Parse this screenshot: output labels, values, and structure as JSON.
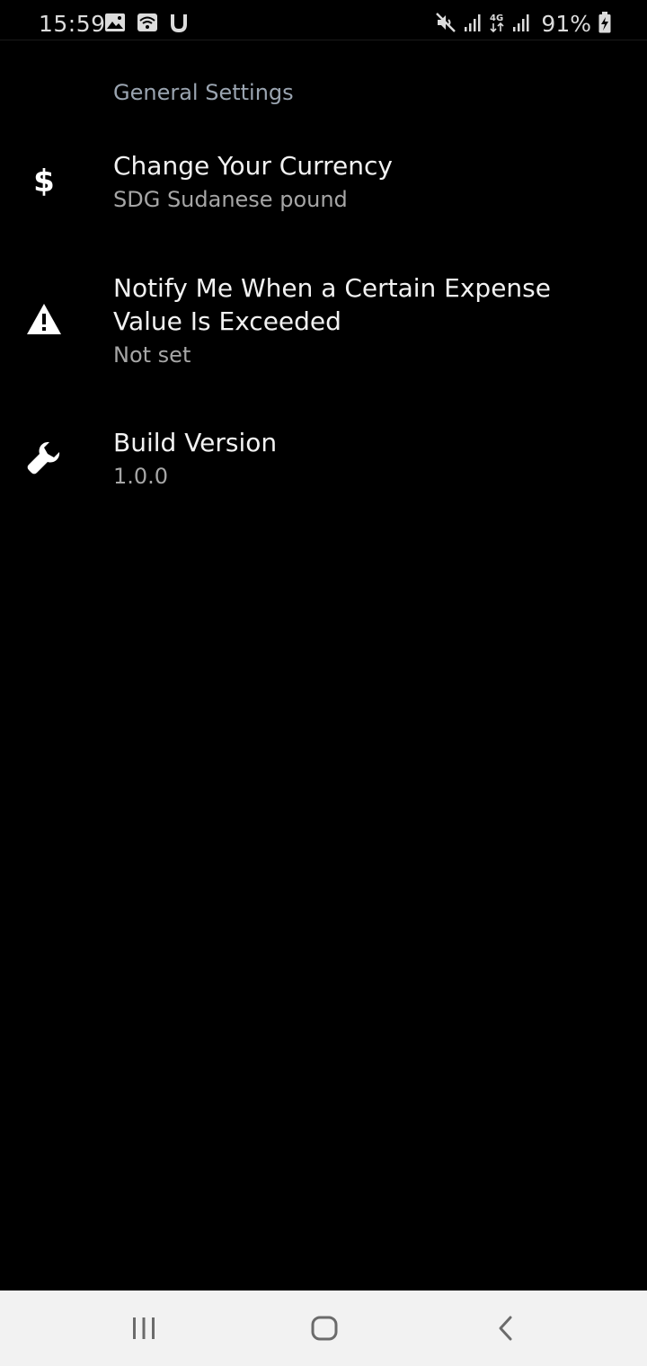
{
  "status_bar": {
    "time": "15:59",
    "battery_percent": "91%",
    "left_icons": [
      "image-icon",
      "wifi-calling-icon",
      "u-app-icon"
    ],
    "right_icons": [
      "mute-icon",
      "signal-icon",
      "4g-data-icon",
      "signal-icon-2",
      "battery-charging-icon"
    ]
  },
  "settings": {
    "section_header": "General Settings",
    "items": [
      {
        "icon": "dollar-icon",
        "title": "Change Your Currency",
        "summary": "SDG Sudanese pound"
      },
      {
        "icon": "warning-icon",
        "title": "Notify Me When a Certain Expense Value Is Exceeded",
        "summary": "Not set"
      },
      {
        "icon": "wrench-icon",
        "title": "Build Version",
        "summary": "1.0.0"
      }
    ]
  },
  "nav_bar": {
    "buttons": [
      "recent-apps-button",
      "home-button",
      "back-button"
    ]
  },
  "colors": {
    "background": "#000000",
    "header_text": "#9aa4b0",
    "title_text": "#f2f2f2",
    "summary_text": "#a6a6a6",
    "nav_bar_bg": "#f2f2f2"
  }
}
